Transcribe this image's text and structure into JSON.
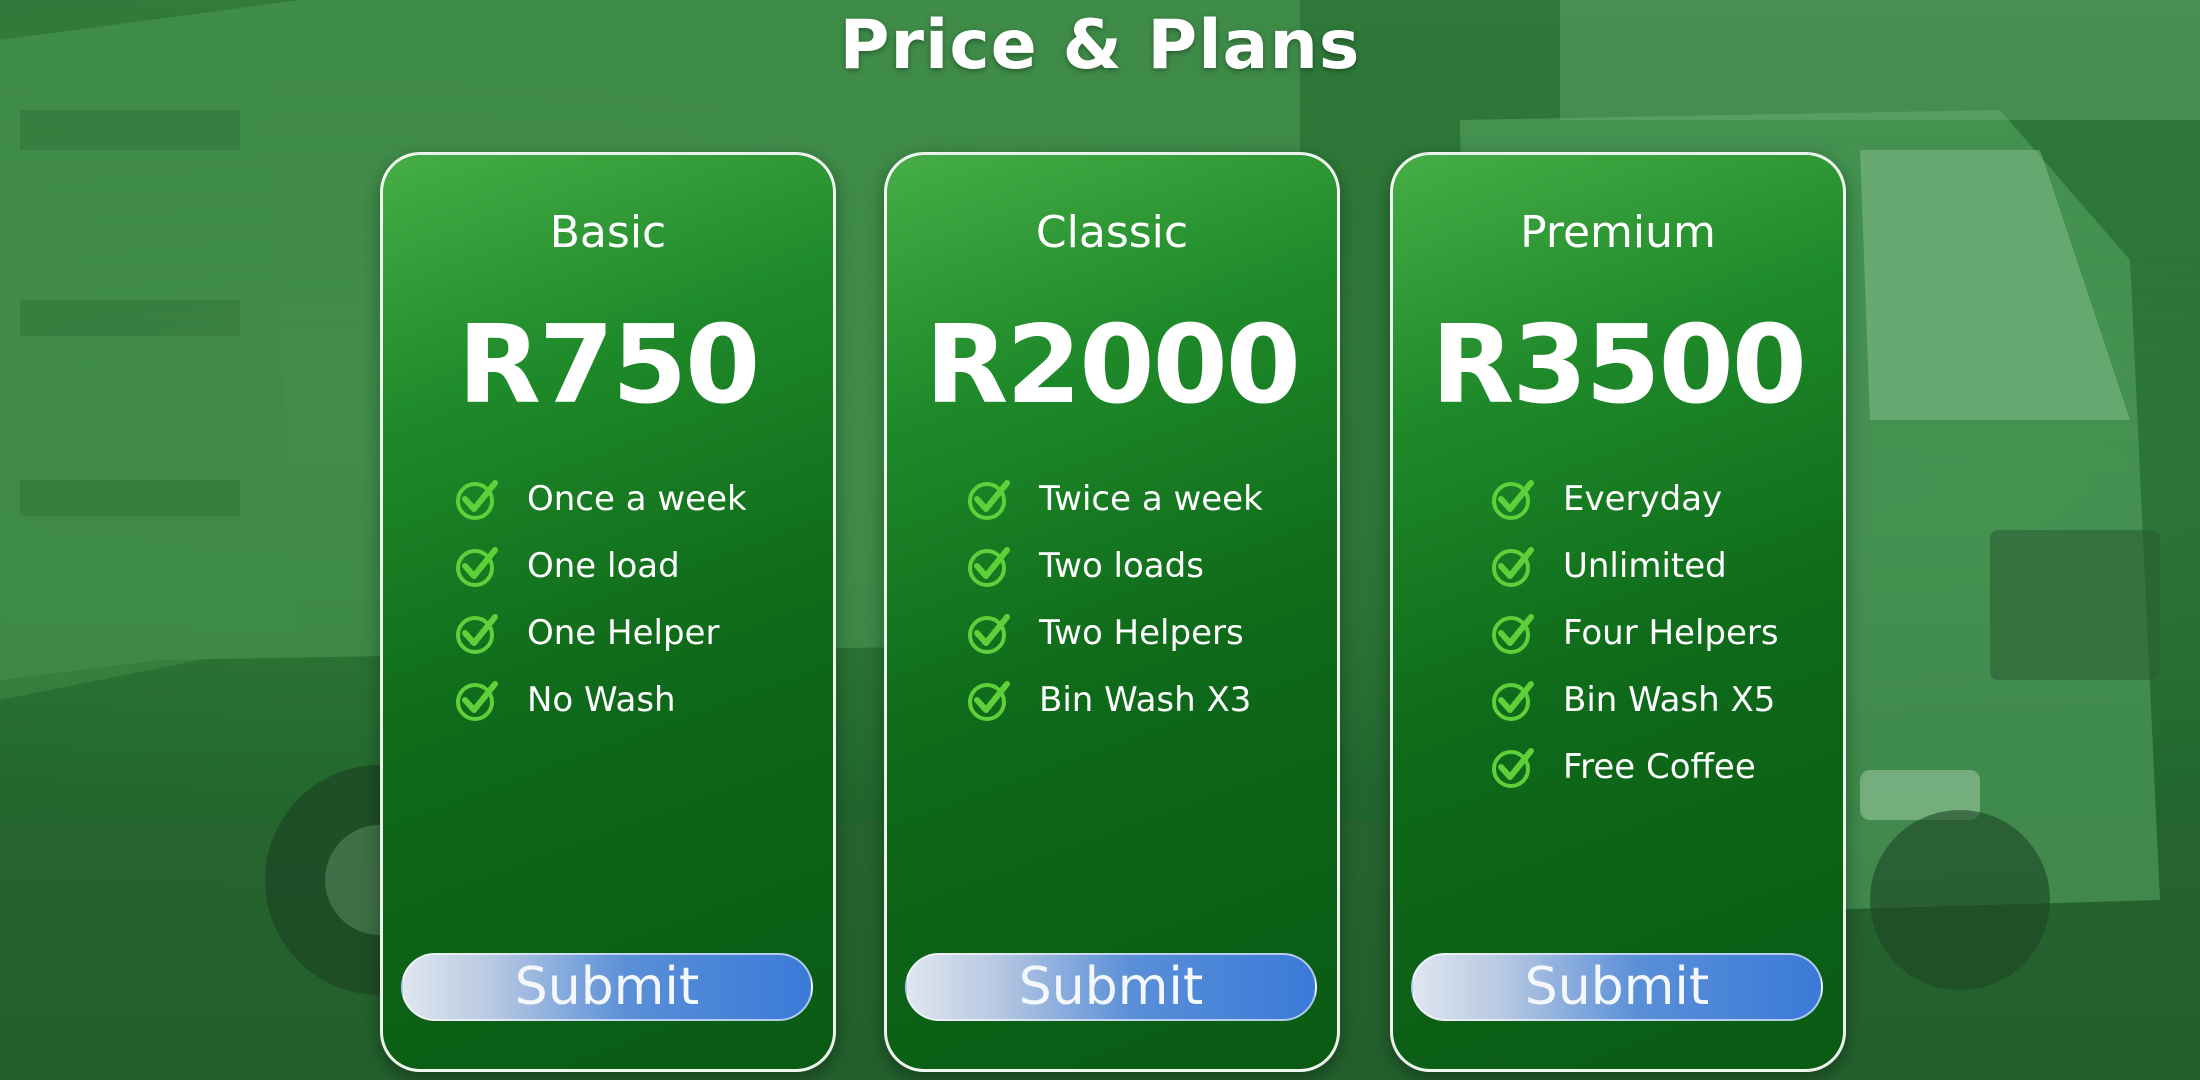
{
  "page": {
    "title": "Price & Plans"
  },
  "plans": [
    {
      "name": "Basic",
      "price": "R750",
      "features": [
        "Once a week",
        "One load",
        "One Helper",
        "No Wash"
      ],
      "submit_label": "Submit"
    },
    {
      "name": "Classic",
      "price": "R2000",
      "features": [
        "Twice a week",
        "Two loads",
        "Two Helpers",
        "Bin Wash X3"
      ],
      "submit_label": "Submit"
    },
    {
      "name": "Premium",
      "price": "R3500",
      "features": [
        "Everyday",
        "Unlimited",
        "Four Helpers",
        "Bin Wash X5",
        "Free Coffee"
      ],
      "submit_label": "Submit"
    }
  ],
  "icons": {
    "feature_icon": "check-circle-icon",
    "background": "garbage-truck-photo"
  },
  "colors": {
    "card_green": "#137a22",
    "check_green": "#5fd03a",
    "button_blue": "#3a7ad8",
    "text": "#ffffff"
  }
}
